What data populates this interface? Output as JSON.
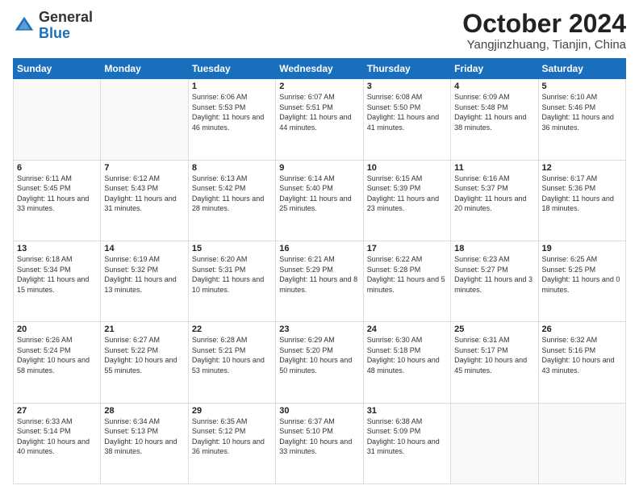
{
  "header": {
    "logo_general": "General",
    "logo_blue": "Blue",
    "month": "October 2024",
    "location": "Yangjinzhuang, Tianjin, China"
  },
  "weekdays": [
    "Sunday",
    "Monday",
    "Tuesday",
    "Wednesday",
    "Thursday",
    "Friday",
    "Saturday"
  ],
  "days": [
    {
      "num": "",
      "info": ""
    },
    {
      "num": "",
      "info": ""
    },
    {
      "num": "1",
      "sunrise": "6:06 AM",
      "sunset": "5:53 PM",
      "daylight": "11 hours and 46 minutes."
    },
    {
      "num": "2",
      "sunrise": "6:07 AM",
      "sunset": "5:51 PM",
      "daylight": "11 hours and 44 minutes."
    },
    {
      "num": "3",
      "sunrise": "6:08 AM",
      "sunset": "5:50 PM",
      "daylight": "11 hours and 41 minutes."
    },
    {
      "num": "4",
      "sunrise": "6:09 AM",
      "sunset": "5:48 PM",
      "daylight": "11 hours and 38 minutes."
    },
    {
      "num": "5",
      "sunrise": "6:10 AM",
      "sunset": "5:46 PM",
      "daylight": "11 hours and 36 minutes."
    },
    {
      "num": "6",
      "sunrise": "6:11 AM",
      "sunset": "5:45 PM",
      "daylight": "11 hours and 33 minutes."
    },
    {
      "num": "7",
      "sunrise": "6:12 AM",
      "sunset": "5:43 PM",
      "daylight": "11 hours and 31 minutes."
    },
    {
      "num": "8",
      "sunrise": "6:13 AM",
      "sunset": "5:42 PM",
      "daylight": "11 hours and 28 minutes."
    },
    {
      "num": "9",
      "sunrise": "6:14 AM",
      "sunset": "5:40 PM",
      "daylight": "11 hours and 25 minutes."
    },
    {
      "num": "10",
      "sunrise": "6:15 AM",
      "sunset": "5:39 PM",
      "daylight": "11 hours and 23 minutes."
    },
    {
      "num": "11",
      "sunrise": "6:16 AM",
      "sunset": "5:37 PM",
      "daylight": "11 hours and 20 minutes."
    },
    {
      "num": "12",
      "sunrise": "6:17 AM",
      "sunset": "5:36 PM",
      "daylight": "11 hours and 18 minutes."
    },
    {
      "num": "13",
      "sunrise": "6:18 AM",
      "sunset": "5:34 PM",
      "daylight": "11 hours and 15 minutes."
    },
    {
      "num": "14",
      "sunrise": "6:19 AM",
      "sunset": "5:32 PM",
      "daylight": "11 hours and 13 minutes."
    },
    {
      "num": "15",
      "sunrise": "6:20 AM",
      "sunset": "5:31 PM",
      "daylight": "11 hours and 10 minutes."
    },
    {
      "num": "16",
      "sunrise": "6:21 AM",
      "sunset": "5:29 PM",
      "daylight": "11 hours and 8 minutes."
    },
    {
      "num": "17",
      "sunrise": "6:22 AM",
      "sunset": "5:28 PM",
      "daylight": "11 hours and 5 minutes."
    },
    {
      "num": "18",
      "sunrise": "6:23 AM",
      "sunset": "5:27 PM",
      "daylight": "11 hours and 3 minutes."
    },
    {
      "num": "19",
      "sunrise": "6:25 AM",
      "sunset": "5:25 PM",
      "daylight": "11 hours and 0 minutes."
    },
    {
      "num": "20",
      "sunrise": "6:26 AM",
      "sunset": "5:24 PM",
      "daylight": "10 hours and 58 minutes."
    },
    {
      "num": "21",
      "sunrise": "6:27 AM",
      "sunset": "5:22 PM",
      "daylight": "10 hours and 55 minutes."
    },
    {
      "num": "22",
      "sunrise": "6:28 AM",
      "sunset": "5:21 PM",
      "daylight": "10 hours and 53 minutes."
    },
    {
      "num": "23",
      "sunrise": "6:29 AM",
      "sunset": "5:20 PM",
      "daylight": "10 hours and 50 minutes."
    },
    {
      "num": "24",
      "sunrise": "6:30 AM",
      "sunset": "5:18 PM",
      "daylight": "10 hours and 48 minutes."
    },
    {
      "num": "25",
      "sunrise": "6:31 AM",
      "sunset": "5:17 PM",
      "daylight": "10 hours and 45 minutes."
    },
    {
      "num": "26",
      "sunrise": "6:32 AM",
      "sunset": "5:16 PM",
      "daylight": "10 hours and 43 minutes."
    },
    {
      "num": "27",
      "sunrise": "6:33 AM",
      "sunset": "5:14 PM",
      "daylight": "10 hours and 40 minutes."
    },
    {
      "num": "28",
      "sunrise": "6:34 AM",
      "sunset": "5:13 PM",
      "daylight": "10 hours and 38 minutes."
    },
    {
      "num": "29",
      "sunrise": "6:35 AM",
      "sunset": "5:12 PM",
      "daylight": "10 hours and 36 minutes."
    },
    {
      "num": "30",
      "sunrise": "6:37 AM",
      "sunset": "5:10 PM",
      "daylight": "10 hours and 33 minutes."
    },
    {
      "num": "31",
      "sunrise": "6:38 AM",
      "sunset": "5:09 PM",
      "daylight": "10 hours and 31 minutes."
    },
    {
      "num": "",
      "info": ""
    },
    {
      "num": "",
      "info": ""
    }
  ],
  "labels": {
    "sunrise": "Sunrise:",
    "sunset": "Sunset:",
    "daylight": "Daylight:"
  }
}
